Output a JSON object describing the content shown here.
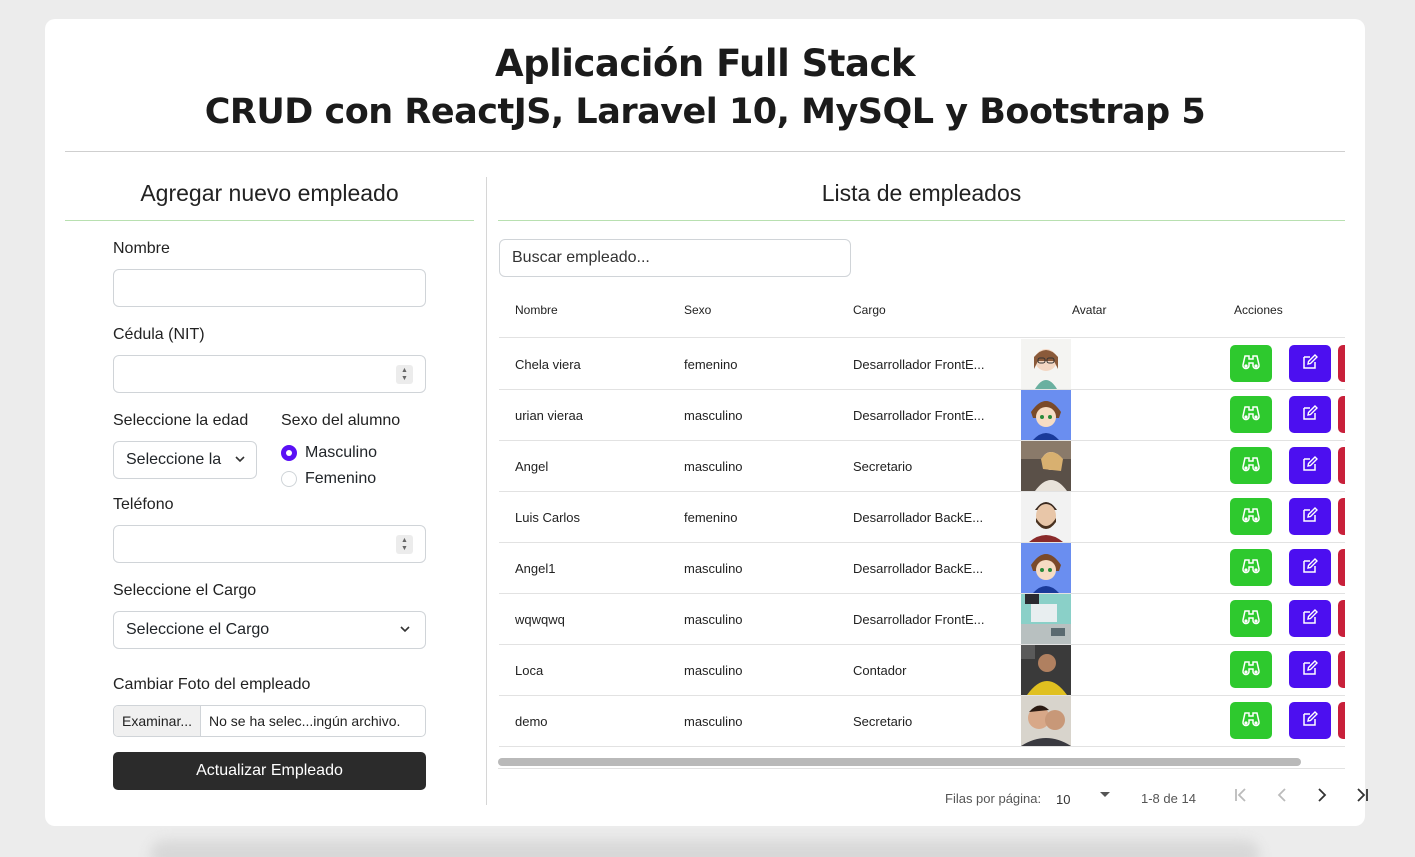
{
  "header": {
    "title_line1": "Aplicación Full Stack",
    "title_line2": "CRUD con ReactJS, Laravel 10, MySQL y Bootstrap 5"
  },
  "form": {
    "section_title": "Agregar nuevo empleado",
    "nombre_label": "Nombre",
    "nombre_value": "",
    "cedula_label": "Cédula (NIT)",
    "cedula_value": "",
    "edad_label": "Seleccione la edad",
    "edad_select_value": "Seleccione la",
    "sexo_label": "Sexo del alumno",
    "sexo_options": [
      "Masculino",
      "Femenino"
    ],
    "sexo_selected": "Masculino",
    "telefono_label": "Teléfono",
    "telefono_value": "",
    "cargo_label": "Seleccione el Cargo",
    "cargo_select_value": "Seleccione el Cargo",
    "foto_label": "Cambiar Foto del empleado",
    "file_button": "Examinar...",
    "file_name": "No se ha selec...ingún archivo.",
    "submit_label": "Actualizar Empleado"
  },
  "list": {
    "section_title": "Lista de empleados",
    "search_placeholder": "Buscar empleado...",
    "columns": [
      "Nombre",
      "Sexo",
      "Cargo",
      "Avatar",
      "Acciones"
    ],
    "rows": [
      {
        "nombre": "Chela viera",
        "sexo": "femenino",
        "cargo": "Desarrollador FrontE...",
        "avatar": "avatar-cartoon-girl"
      },
      {
        "nombre": "urian vieraa",
        "sexo": "masculino",
        "cargo": "Desarrollador FrontE...",
        "avatar": "avatar-anime-boy"
      },
      {
        "nombre": "Angel",
        "sexo": "masculino",
        "cargo": "Secretario",
        "avatar": "avatar-woman-photo"
      },
      {
        "nombre": "Luis Carlos",
        "sexo": "femenino",
        "cargo": "Desarrollador BackE...",
        "avatar": "avatar-bearded-man"
      },
      {
        "nombre": "Angel1",
        "sexo": "masculino",
        "cargo": "Desarrollador BackE...",
        "avatar": "avatar-anime-boy"
      },
      {
        "nombre": "wqwqwq",
        "sexo": "masculino",
        "cargo": "Desarrollador FrontE...",
        "avatar": "avatar-desk-photo"
      },
      {
        "nombre": "Loca",
        "sexo": "masculino",
        "cargo": "Contador",
        "avatar": "avatar-yellow-shirt-photo"
      },
      {
        "nombre": "demo",
        "sexo": "masculino",
        "cargo": "Secretario",
        "avatar": "avatar-selfie-photo"
      }
    ],
    "pagination": {
      "rows_per_page_label": "Filas por página:",
      "rows_per_page_value": "10",
      "range_text": "1-8 de 14"
    }
  },
  "colors": {
    "view_button": "#2ec92e",
    "edit_button": "#4c0ff0",
    "delete_button": "#c8203a",
    "submit_button": "#2b2b2b",
    "radio_accent": "#5a10f5"
  }
}
